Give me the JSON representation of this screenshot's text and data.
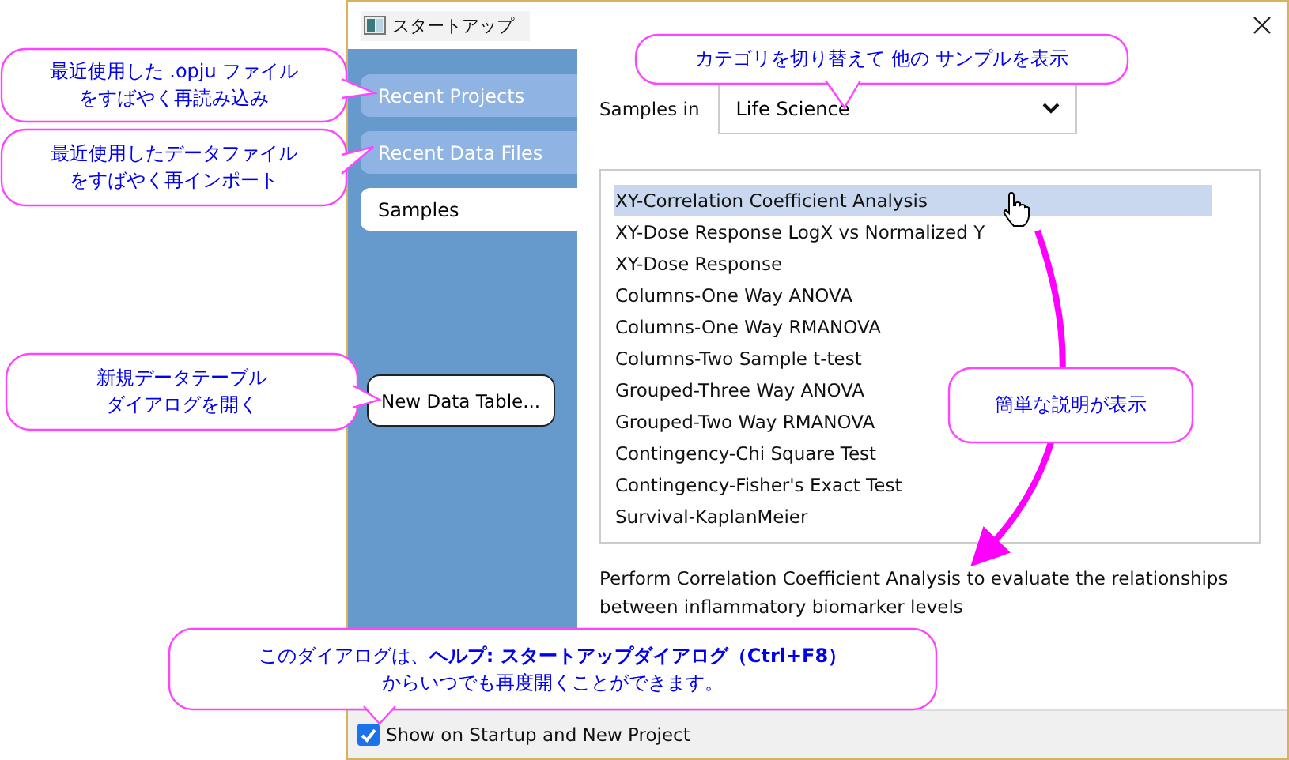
{
  "window": {
    "title": "スタートアップ"
  },
  "sidebar": {
    "items": [
      {
        "label": "Recent Projects",
        "selected": false
      },
      {
        "label": "Recent Data Files",
        "selected": false
      },
      {
        "label": "Samples",
        "selected": true
      }
    ],
    "button": "New Data Table..."
  },
  "samples_in": {
    "label": "Samples in",
    "value": "Life Science"
  },
  "samples": [
    {
      "label": "XY-Correlation Coefficient Analysis",
      "selected": true
    },
    {
      "label": "XY-Dose Response LogX vs Normalized Y",
      "selected": false
    },
    {
      "label": "XY-Dose Response",
      "selected": false
    },
    {
      "label": "Columns-One Way ANOVA",
      "selected": false
    },
    {
      "label": "Columns-One Way RMANOVA",
      "selected": false
    },
    {
      "label": "Columns-Two Sample t-test",
      "selected": false
    },
    {
      "label": "Grouped-Three Way ANOVA",
      "selected": false
    },
    {
      "label": "Grouped-Two Way RMANOVA",
      "selected": false
    },
    {
      "label": "Contingency-Chi Square Test",
      "selected": false
    },
    {
      "label": "Contingency-Fisher's Exact Test",
      "selected": false
    },
    {
      "label": "Survival-KaplanMeier",
      "selected": false
    }
  ],
  "description": "Perform Correlation Coefficient Analysis to evaluate the relationships between inflammatory biomarker levels",
  "footer": {
    "label": "Show on Startup and New Project",
    "checked": true
  },
  "callouts": [
    {
      "lines": [
        "最近使用した .opju ファイル",
        "をすばやく再読み込み"
      ]
    },
    {
      "lines": [
        "最近使用したデータファイル",
        "をすばやく再インポート"
      ]
    },
    {
      "lines": [
        "新規データテーブル",
        "ダイアログを開く"
      ]
    },
    {
      "lines": [
        "カテゴリを切り替えて 他の サンプルを表示"
      ]
    },
    {
      "lines": [
        "簡単な説明が表示"
      ]
    },
    {
      "lines": [
        "このダイアログは、**ヘルプ: スタートアップダイアログ（Ctrl+F8）**",
        "からいつでも再度開くことができます。"
      ]
    }
  ]
}
